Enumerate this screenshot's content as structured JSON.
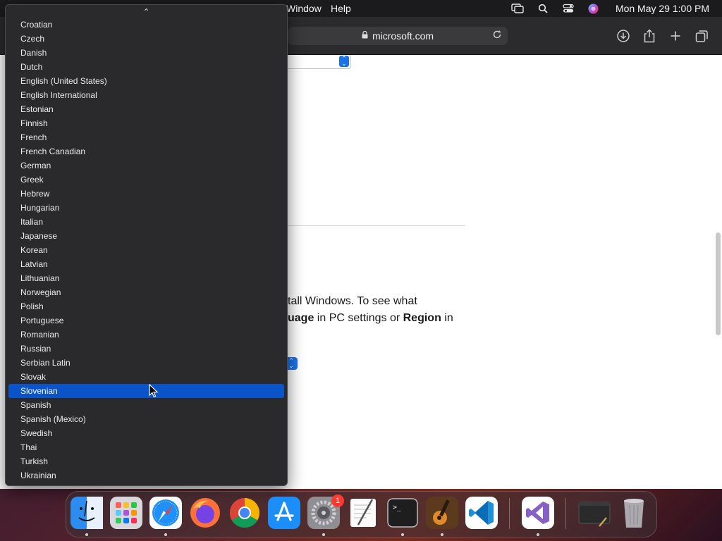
{
  "menubar": {
    "window_label": "Window",
    "help_label": "Help",
    "clock": "Mon May 29  1:00 PM"
  },
  "browser": {
    "url": "microsoft.com",
    "paragraph": {
      "line1": "tall Windows. To see what",
      "line2_bold1": "uage",
      "line2_mid": " in PC settings or ",
      "line2_bold2": "Region",
      "line2_end": " in"
    }
  },
  "dropdown": {
    "scroll_up_glyph": "⌃",
    "options": [
      "Croatian",
      "Czech",
      "Danish",
      "Dutch",
      "English (United States)",
      "English International",
      "Estonian",
      "Finnish",
      "French",
      "French Canadian",
      "German",
      "Greek",
      "Hebrew",
      "Hungarian",
      "Italian",
      "Japanese",
      "Korean",
      "Latvian",
      "Lithuanian",
      "Norwegian",
      "Polish",
      "Portuguese",
      "Romanian",
      "Russian",
      "Serbian Latin",
      "Slovak",
      "Slovenian",
      "Spanish",
      "Spanish (Mexico)",
      "Swedish",
      "Thai",
      "Turkish",
      "Ukrainian"
    ],
    "selected": "Slovenian"
  },
  "dock": {
    "apps": [
      {
        "name": "finder-icon"
      },
      {
        "name": "launchpad-icon"
      },
      {
        "name": "safari-icon"
      },
      {
        "name": "firefox-icon"
      },
      {
        "name": "chrome-icon"
      },
      {
        "name": "app-store-icon"
      },
      {
        "name": "system-settings-icon"
      },
      {
        "name": "textedit-icon"
      },
      {
        "name": "terminal-icon"
      },
      {
        "name": "garageband-icon"
      },
      {
        "name": "vscode-icon"
      },
      {
        "name": "visual-studio-icon"
      },
      {
        "name": "window-preview-icon"
      },
      {
        "name": "trash-icon"
      }
    ],
    "settings_badge": "1",
    "terminal_prompt": ">_"
  },
  "colors": {
    "selection": "#0a53c9",
    "dropdown_bg": "#2a2a2c",
    "menubar_bg": "#1b1b1d"
  }
}
